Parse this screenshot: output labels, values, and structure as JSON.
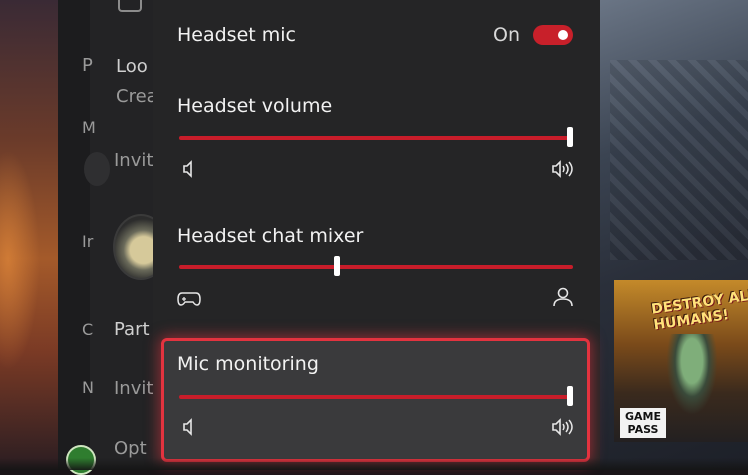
{
  "background": {
    "guide_items": [
      "Loo",
      "Crea",
      "Invit",
      "Part",
      "Invit",
      "Opt"
    ],
    "guide_letters": [
      "P",
      "M",
      "Ir",
      "C",
      "N"
    ]
  },
  "game_tile": {
    "title": "DESTROY ALL HUMANS!",
    "badge": "GAME PASS"
  },
  "quick_settings": {
    "headset_mic": {
      "label": "Headset mic",
      "state_label": "On",
      "enabled": true
    },
    "headset_volume": {
      "label": "Headset volume",
      "value": 1.0,
      "left_icon": "speaker-low-icon",
      "right_icon": "speaker-high-icon"
    },
    "headset_chat_mixer": {
      "label": "Headset chat mixer",
      "value": 0.4,
      "left_icon": "controller-icon",
      "right_icon": "person-icon"
    },
    "mic_monitoring": {
      "label": "Mic monitoring",
      "value": 1.0,
      "left_icon": "speaker-low-icon",
      "right_icon": "speaker-high-icon",
      "focused": true
    }
  },
  "colors": {
    "accent": "#c81d2a",
    "focus_border": "#e3333f",
    "panel_bg": "#252526"
  }
}
